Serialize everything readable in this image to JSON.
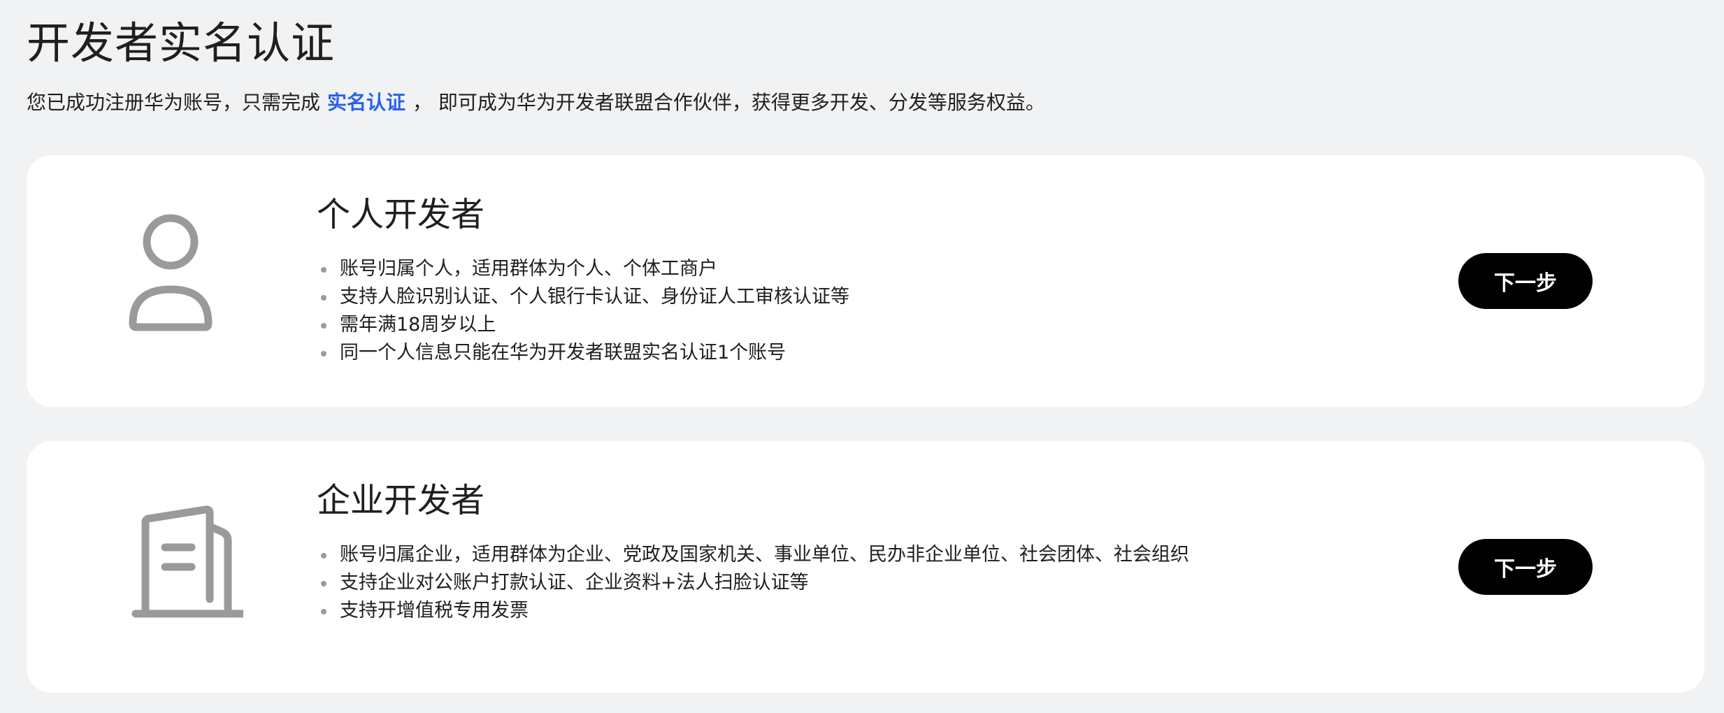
{
  "page": {
    "title": "开发者实名认证",
    "intro_prefix": "您已成功注册华为账号，只需完成",
    "intro_link": "实名认证",
    "intro_suffix": "， 即可成为华为开发者联盟合作伙伴，获得更多开发、分发等服务权益。"
  },
  "cards": [
    {
      "icon": "person-icon",
      "title": "个人开发者",
      "features": [
        "账号归属个人，适用群体为个人、个体工商户",
        "支持人脸识别认证、个人银行卡认证、身份证人工审核认证等",
        "需年满18周岁以上",
        "同一个人信息只能在华为开发者联盟实名认证1个账号"
      ],
      "button_label": "下一步"
    },
    {
      "icon": "building-icon",
      "title": "企业开发者",
      "features": [
        "账号归属企业，适用群体为企业、党政及国家机关、事业单位、民办非企业单位、社会团体、社会组织",
        "支持企业对公账户打款认证、企业资料+法人扫脸认证等",
        "支持开增值税专用发票"
      ],
      "button_label": "下一步"
    }
  ],
  "colors": {
    "background": "#f1f2f4",
    "card": "#ffffff",
    "link": "#2563eb",
    "button": "#000000",
    "icon": "#9a9a9a"
  }
}
